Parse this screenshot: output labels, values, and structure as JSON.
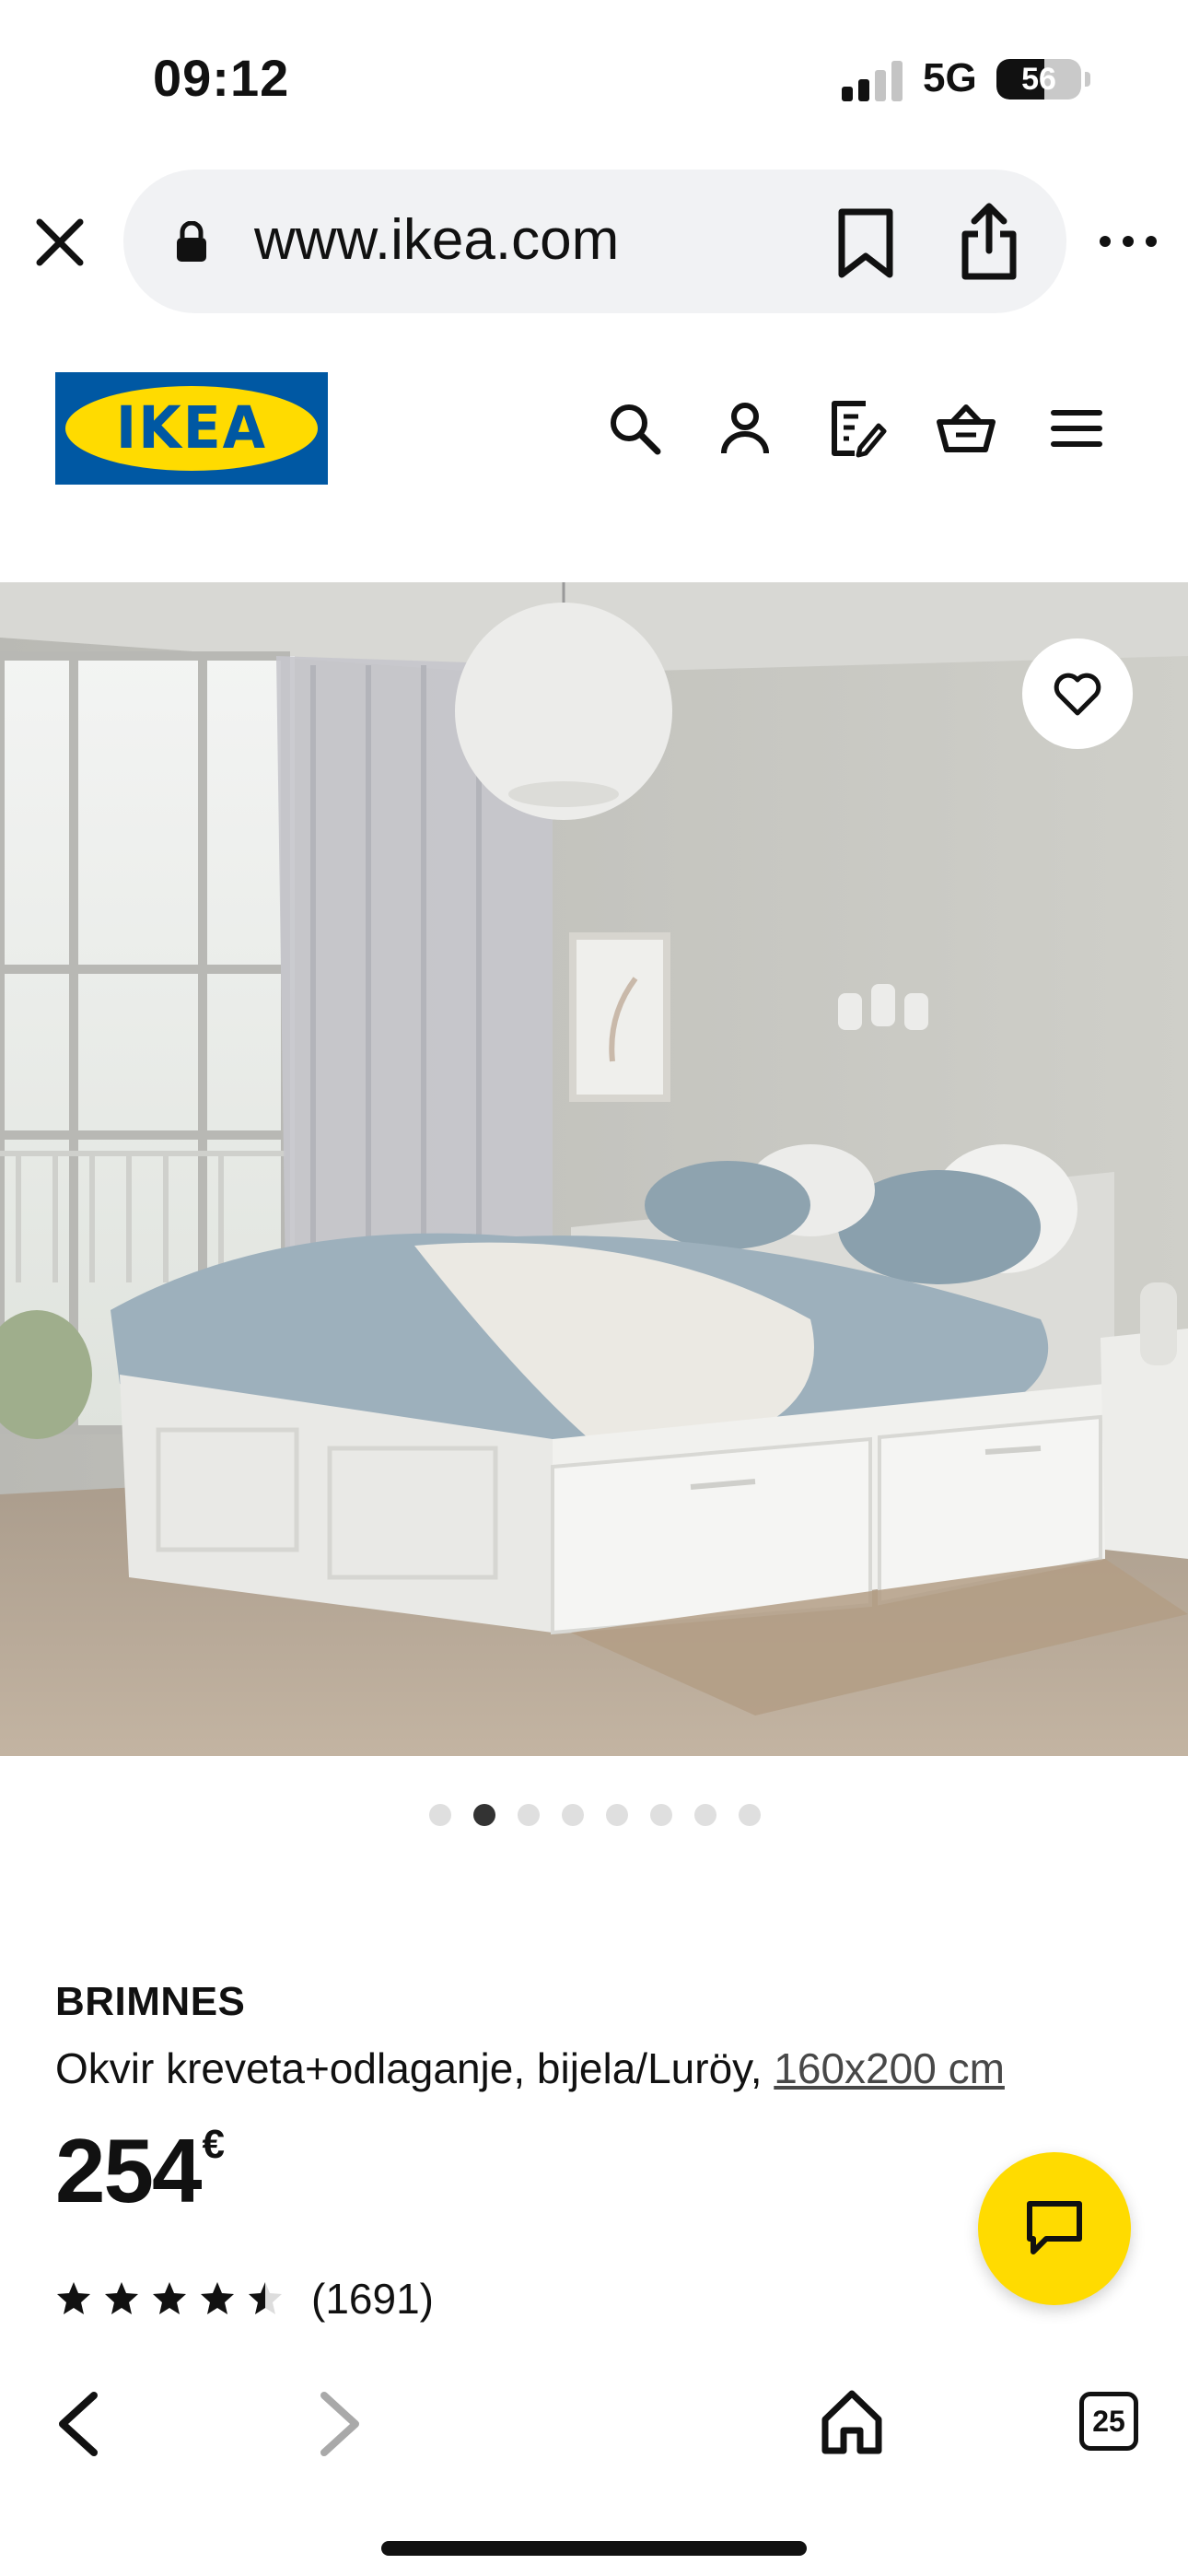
{
  "status_bar": {
    "time": "09:12",
    "network": "5G",
    "battery": "56",
    "battery_level": 0.56
  },
  "browser": {
    "url": "www.ikea.com",
    "tab_count": "25"
  },
  "header": {
    "logo_text": "IKEA",
    "icons": [
      "search-icon",
      "account-icon",
      "shopping-list-icon",
      "basket-icon",
      "menu-icon"
    ]
  },
  "product": {
    "name": "BRIMNES",
    "description": "Okvir kreveta+odlaganje, bijela/Luröy,",
    "size": "160x200 cm",
    "price": "254",
    "currency": "€",
    "rating_value": 4.5,
    "rating_max": 5,
    "review_count": "(1691)"
  },
  "carousel": {
    "slide_count": 8,
    "active_index": 1
  },
  "colors": {
    "ikea_blue": "#0058a3",
    "ikea_yellow": "#ffdb00"
  }
}
